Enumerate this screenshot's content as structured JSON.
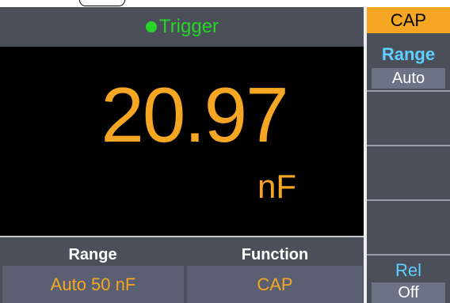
{
  "status": {
    "label": "Trigger"
  },
  "measurement": {
    "value": "20.97",
    "unit": "nF"
  },
  "footer": {
    "range_label": "Range",
    "function_label": "Function",
    "range_value": "Auto 50 nF",
    "function_value": "CAP"
  },
  "softkeys": {
    "mode_tab": "CAP",
    "range_title": "Range",
    "range_value": "Auto",
    "rel_title": "Rel",
    "rel_value": "Off"
  },
  "colors": {
    "accent": "#f5a623",
    "trigger_green": "#28d428",
    "softkey_title": "#5fd0ff",
    "panel_bg": "#4a4f5a",
    "display_bg": "#000000"
  }
}
